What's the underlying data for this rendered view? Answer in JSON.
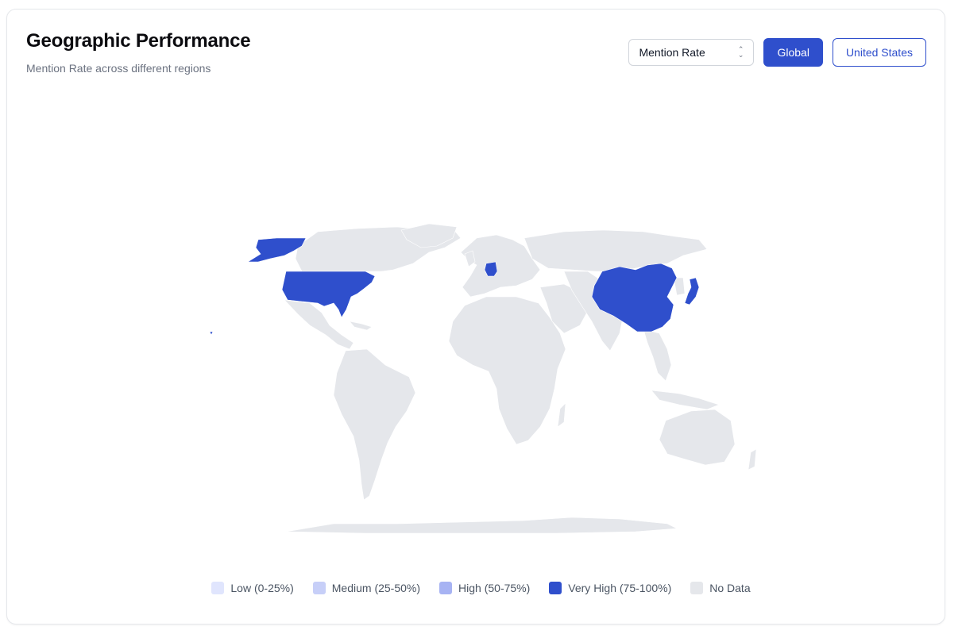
{
  "header": {
    "title": "Geographic Performance",
    "subtitle": "Mention Rate across different regions"
  },
  "controls": {
    "metric_select": "Mention Rate",
    "buttons": [
      {
        "label": "Global",
        "active": true
      },
      {
        "label": "United States",
        "active": false
      }
    ]
  },
  "legend": [
    {
      "label": "Low (0-25%)",
      "color": "#e0e5fd"
    },
    {
      "label": "Medium (25-50%)",
      "color": "#c7cff8"
    },
    {
      "label": "High (50-75%)",
      "color": "#a7b3f3"
    },
    {
      "label": "Very High (75-100%)",
      "color": "#2f4fcc"
    },
    {
      "label": "No Data",
      "color": "#e5e7eb"
    }
  ],
  "map": {
    "no_data_color": "#e5e7eb",
    "very_high_color": "#2f4fcc",
    "very_high_regions": [
      "United States",
      "China",
      "Japan",
      "Germany"
    ]
  }
}
